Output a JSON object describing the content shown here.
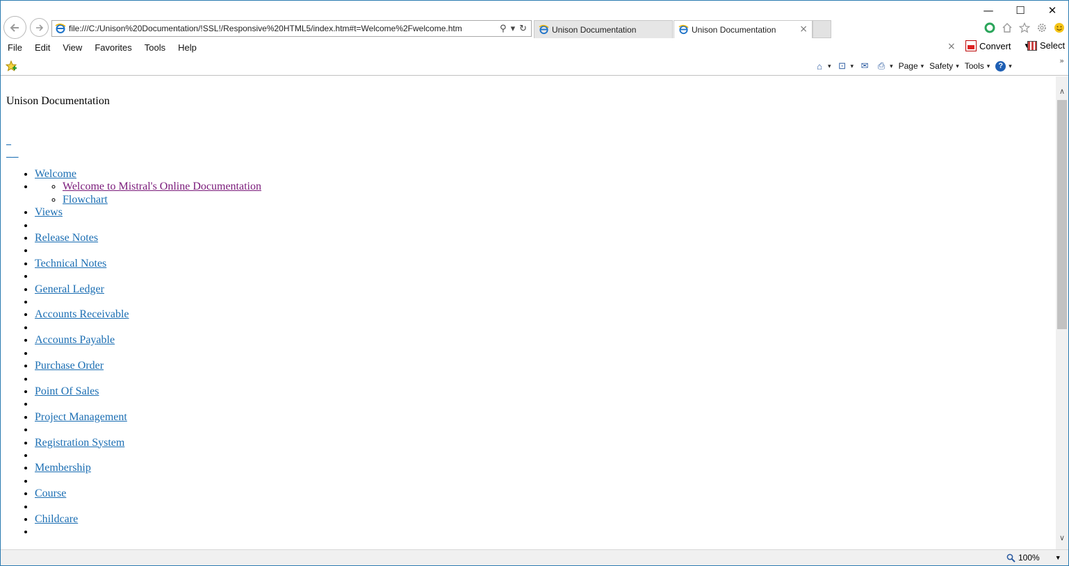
{
  "window": {
    "controls": {
      "minimize": "—",
      "maximize": "☐",
      "close": "✕"
    }
  },
  "address_bar": {
    "url": "file:///C:/Unison%20Documentation/!SSL!/Responsive%20HTML5/index.htm#t=Welcome%2Fwelcome.htm",
    "search_icon": "⚲",
    "dropdown_icon": "▾",
    "refresh_icon": "↻"
  },
  "tabs": [
    {
      "label": "Unison Documentation",
      "active": false
    },
    {
      "label": "Unison Documentation",
      "active": true,
      "close": "×"
    }
  ],
  "menu": {
    "items": [
      "File",
      "Edit",
      "View",
      "Favorites",
      "Tools",
      "Help"
    ]
  },
  "pdf_toolbar": {
    "close": "×",
    "convert_label": "Convert",
    "convert_caret": "▼",
    "select_label": "Select"
  },
  "command_bar": {
    "items": [
      {
        "name": "home",
        "icon": "⌂",
        "label": ""
      },
      {
        "name": "feeds",
        "icon": "⊡",
        "label": ""
      },
      {
        "name": "read-mail",
        "icon": "✉",
        "label": ""
      },
      {
        "name": "print",
        "icon": "⎙",
        "label": ""
      },
      {
        "name": "page",
        "icon": "",
        "label": "Page"
      },
      {
        "name": "safety",
        "icon": "",
        "label": "Safety"
      },
      {
        "name": "tools",
        "icon": "",
        "label": "Tools"
      },
      {
        "name": "help",
        "icon": "?",
        "label": ""
      }
    ],
    "chevron": "»",
    "dropdown_caret": "▾"
  },
  "page": {
    "title": "Unison Documentation",
    "spacer_link_1": "_",
    "spacer_link_2": "_ _",
    "toc": [
      {
        "label": "Welcome",
        "children": [
          "Welcome to Mistral's Online Documentation",
          "Flowchart"
        ]
      },
      {
        "label": "Views"
      },
      {
        "label": "Release Notes"
      },
      {
        "label": "Technical Notes"
      },
      {
        "label": "General Ledger"
      },
      {
        "label": "Accounts Receivable"
      },
      {
        "label": "Accounts Payable"
      },
      {
        "label": "Purchase Order"
      },
      {
        "label": "Point Of Sales"
      },
      {
        "label": "Project Management"
      },
      {
        "label": "Registration System"
      },
      {
        "label": "Membership"
      },
      {
        "label": "Course"
      },
      {
        "label": "Childcare"
      }
    ]
  },
  "status_bar": {
    "zoom_label": "100%",
    "zoom_caret": "▼"
  },
  "scrollbar": {
    "up": "∧",
    "down": "∨"
  },
  "colors": {
    "link": "#1b6eb3",
    "visited_link": "#7a1a7a",
    "window_border": "#2a7ab0",
    "chrome_bg": "#ffffff",
    "statusbar_bg": "#f0f0f0"
  }
}
